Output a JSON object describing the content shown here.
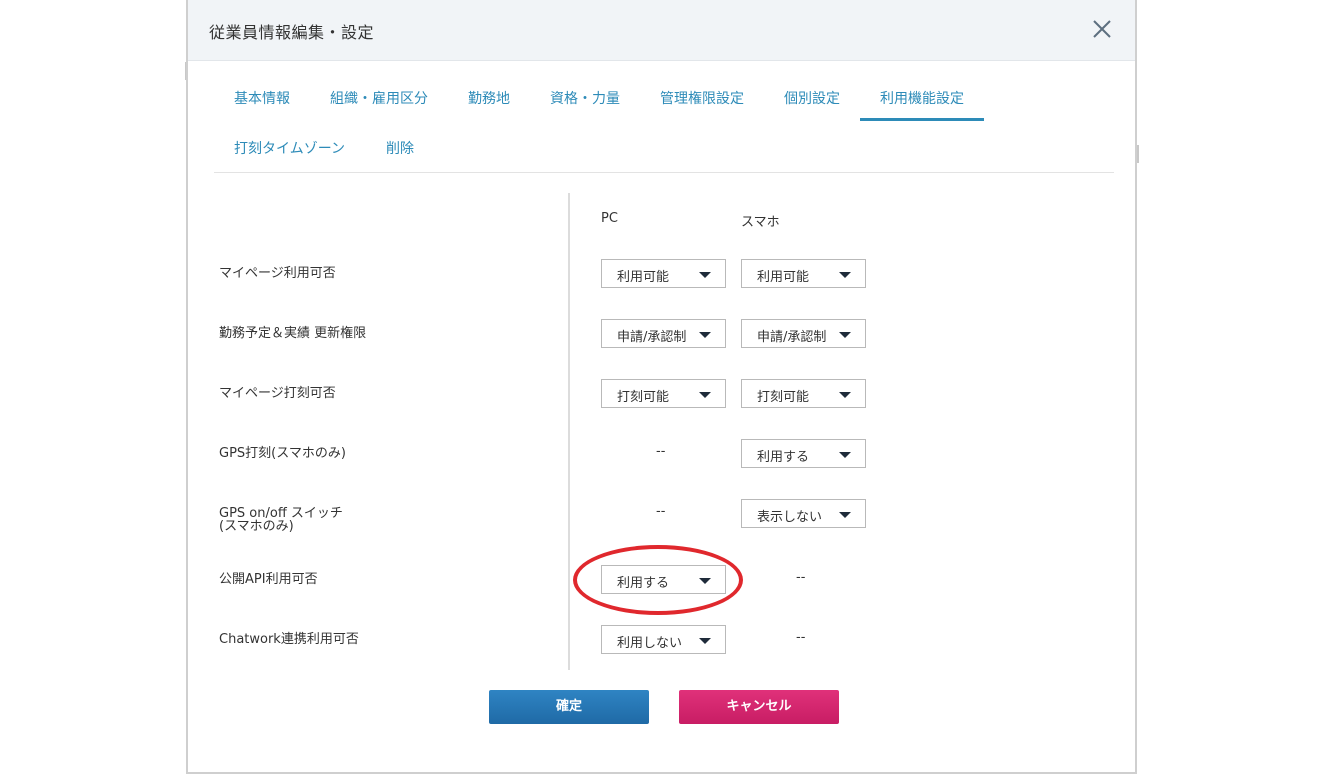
{
  "dialog": {
    "title": "従業員情報編集・設定"
  },
  "tabs": [
    {
      "label": "基本情報"
    },
    {
      "label": "組織・雇用区分"
    },
    {
      "label": "勤務地"
    },
    {
      "label": "資格・力量"
    },
    {
      "label": "管理権限設定"
    },
    {
      "label": "個別設定"
    },
    {
      "label": "利用機能設定",
      "active": true
    },
    {
      "label": "打刻タイムゾーン"
    },
    {
      "label": "削除"
    }
  ],
  "columns": {
    "pc": "PC",
    "smartphone": "スマホ"
  },
  "rows": [
    {
      "label": "マイページ利用可否",
      "pc": "利用可能",
      "smartphone": "利用可能"
    },
    {
      "label": "勤務予定＆実績 更新権限",
      "pc": "申請/承認制",
      "smartphone": "申請/承認制"
    },
    {
      "label": "マイページ打刻可否",
      "pc": "打刻可能",
      "smartphone": "打刻可能"
    },
    {
      "label": "GPS打刻(スマホのみ)",
      "pc": "--",
      "smartphone": "利用する"
    },
    {
      "label_line1": "GPS on/off スイッチ",
      "label_line2": "(スマホのみ)",
      "pc": "--",
      "smartphone": "表示しない"
    },
    {
      "label": "公開API利用可否",
      "pc": "利用する",
      "smartphone": "--"
    },
    {
      "label": "Chatwork連携利用可否",
      "pc": "利用しない",
      "smartphone": "--"
    }
  ],
  "buttons": {
    "confirm": "確定",
    "cancel": "キャンセル"
  },
  "colors": {
    "accent": "#2d8bb8",
    "confirm": "#2577b5",
    "cancel": "#d8266f",
    "highlight": "#e0282d"
  }
}
